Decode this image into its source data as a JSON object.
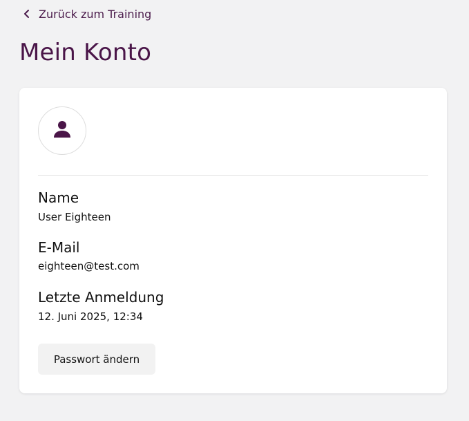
{
  "back_link": {
    "label": "Zurück zum Training",
    "icon": "chevron-left-icon"
  },
  "page": {
    "title": "Mein Konto"
  },
  "profile": {
    "avatar_icon": "user-icon",
    "fields": [
      {
        "label": "Name",
        "value": "User Eighteen"
      },
      {
        "label": "E-Mail",
        "value": "eighteen@test.com"
      },
      {
        "label": "Letzte Anmeldung",
        "value": "12. Juni 2025, 12:34"
      }
    ],
    "change_password_label": "Passwort ändern"
  },
  "colors": {
    "accent": "#4a1548",
    "background": "#f2f2f3",
    "card": "#ffffff",
    "button_bg": "#f2f2f2"
  }
}
